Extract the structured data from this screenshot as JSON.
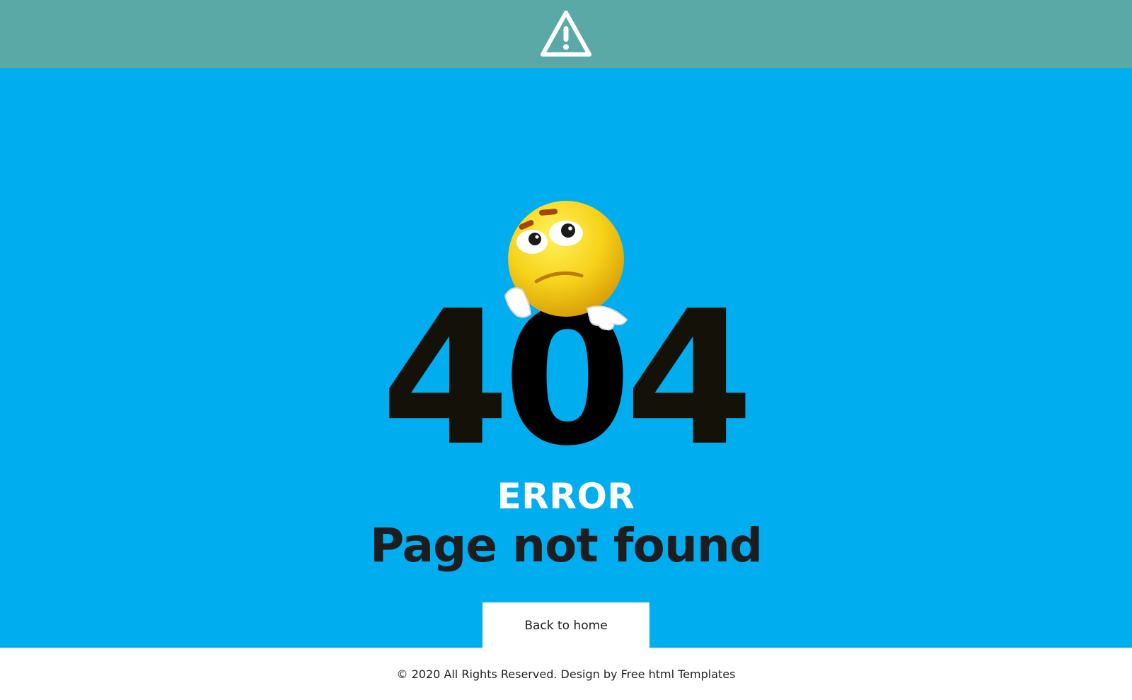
{
  "colors": {
    "topbar": "#5ba9a7",
    "main_bg": "#00adef",
    "digits": "#141108",
    "error_label": "#ffffff",
    "headline": "#1d1d1f",
    "button_bg": "#ffffff",
    "footer_bg": "#ffffff"
  },
  "header": {
    "icon": "warning-triangle-icon"
  },
  "hero": {
    "digits": [
      "4",
      "0",
      "4"
    ],
    "emoji": "thinking-face-emoji",
    "error_label": "ERROR",
    "headline": "Page not found"
  },
  "cta": {
    "label": "Back to home"
  },
  "footer": {
    "text": "© 2020 All Rights Reserved. Design by Free html Templates"
  }
}
